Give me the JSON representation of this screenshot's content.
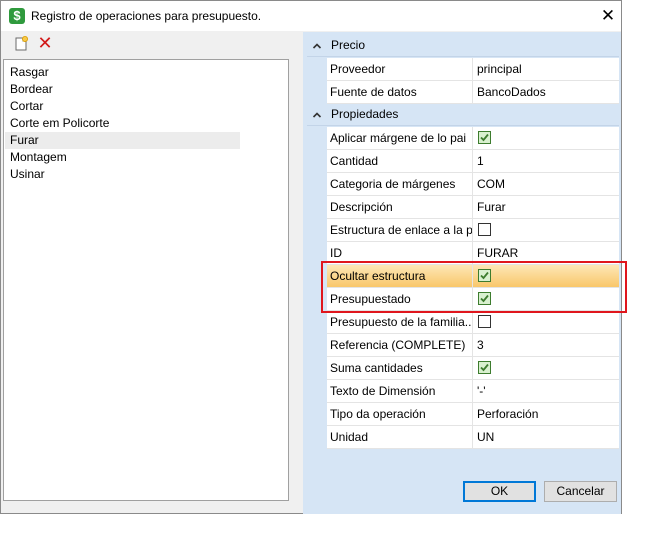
{
  "window": {
    "title": "Registro de operaciones para presupuesto.",
    "app_icon_glyph": "$",
    "close_glyph": "✕"
  },
  "toolbar": {
    "new_icon": "new-document-icon",
    "delete_icon": "delete-icon",
    "delete_glyph": "✕"
  },
  "operations": [
    {
      "label": "Rasgar",
      "selected": false
    },
    {
      "label": "Bordear",
      "selected": false
    },
    {
      "label": "Cortar",
      "selected": false
    },
    {
      "label": "Corte em Policorte",
      "selected": false
    },
    {
      "label": "Furar",
      "selected": true
    },
    {
      "label": "Montagem",
      "selected": false
    },
    {
      "label": "Usinar",
      "selected": false
    }
  ],
  "categories": [
    {
      "label": "Precio",
      "expanded": true,
      "rows": [
        {
          "name": "Proveedor",
          "type": "text",
          "value": "principal"
        },
        {
          "name": "Fuente de datos",
          "type": "text",
          "value": "BancoDados"
        }
      ]
    },
    {
      "label": "Propiedades",
      "expanded": true,
      "rows": [
        {
          "name": "Aplicar márgene de lo pai",
          "type": "checkbox",
          "checked": true
        },
        {
          "name": "Cantidad",
          "type": "text",
          "value": "1"
        },
        {
          "name": "Categoria de márgenes",
          "type": "text",
          "value": "COM"
        },
        {
          "name": "Descripción",
          "type": "text",
          "value": "Furar"
        },
        {
          "name": "Estructura de enlace a la p...",
          "type": "checkbox",
          "checked": false
        },
        {
          "name": "ID",
          "type": "text",
          "value": "FURAR"
        },
        {
          "name": "Ocultar estructura",
          "type": "checkbox",
          "checked": true,
          "highlighted": true
        },
        {
          "name": "Presupuestado",
          "type": "checkbox",
          "checked": true
        },
        {
          "name": "Presupuesto de la familia...",
          "type": "checkbox",
          "checked": false
        },
        {
          "name": "Referencia (COMPLETE)",
          "type": "text",
          "value": "3"
        },
        {
          "name": "Suma cantidades",
          "type": "checkbox",
          "checked": true
        },
        {
          "name": "Texto de Dimensión",
          "type": "text",
          "value": "'-'"
        },
        {
          "name": "Tipo da operación",
          "type": "text",
          "value": "Perforación"
        },
        {
          "name": "Unidad",
          "type": "text",
          "value": "UN"
        }
      ]
    }
  ],
  "buttons": {
    "ok": "OK",
    "cancel": "Cancelar"
  },
  "colors": {
    "highlight_row": "#f9c76a",
    "annotation_box": "#e0161d",
    "checkbox_check": "#3d7c2e",
    "grid_background": "#d6e5f5"
  }
}
